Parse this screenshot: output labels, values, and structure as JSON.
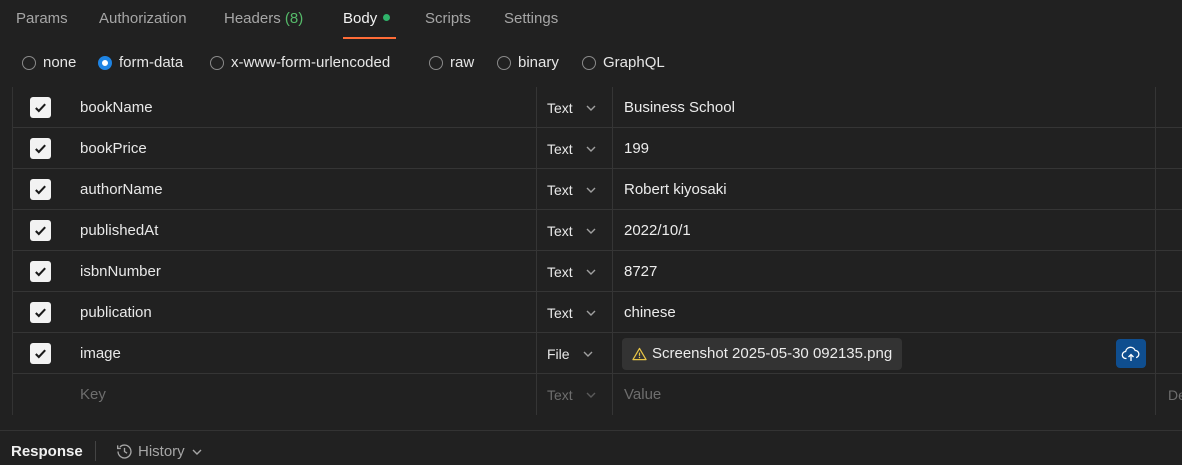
{
  "tabs": [
    {
      "label": "Params"
    },
    {
      "label": "Authorization"
    },
    {
      "label": "Headers",
      "count": "(8)"
    },
    {
      "label": "Body"
    },
    {
      "label": "Scripts"
    },
    {
      "label": "Settings"
    }
  ],
  "body_modes": [
    {
      "label": "none",
      "selected": false
    },
    {
      "label": "form-data",
      "selected": true
    },
    {
      "label": "x-www-form-urlencoded",
      "selected": false
    },
    {
      "label": "raw",
      "selected": false
    },
    {
      "label": "binary",
      "selected": false
    },
    {
      "label": "GraphQL",
      "selected": false
    }
  ],
  "rows": [
    {
      "checked": true,
      "key": "bookName",
      "type": "Text",
      "value": "Business School"
    },
    {
      "checked": true,
      "key": "bookPrice",
      "type": "Text",
      "value": "199"
    },
    {
      "checked": true,
      "key": "authorName",
      "type": "Text",
      "value": "Robert kiyosaki"
    },
    {
      "checked": true,
      "key": "publishedAt",
      "type": "Text",
      "value": "2022/10/1"
    },
    {
      "checked": true,
      "key": "isbnNumber",
      "type": "Text",
      "value": "8727"
    },
    {
      "checked": true,
      "key": "publication",
      "type": "Text",
      "value": "chinese"
    },
    {
      "checked": true,
      "key": "image",
      "type": "File",
      "value": "Screenshot 2025-05-30 092135.png"
    }
  ],
  "new_row": {
    "key_placeholder": "Key",
    "type": "Text",
    "value_placeholder": "Value",
    "desc_placeholder": "De"
  },
  "bottom": {
    "response_label": "Response",
    "history_label": "History"
  },
  "colors": {
    "accent_underline": "#ff6c37",
    "body_dot": "#2fb36a",
    "radio_selected": "#1e84e4",
    "upload_button": "#0f4e8f"
  }
}
